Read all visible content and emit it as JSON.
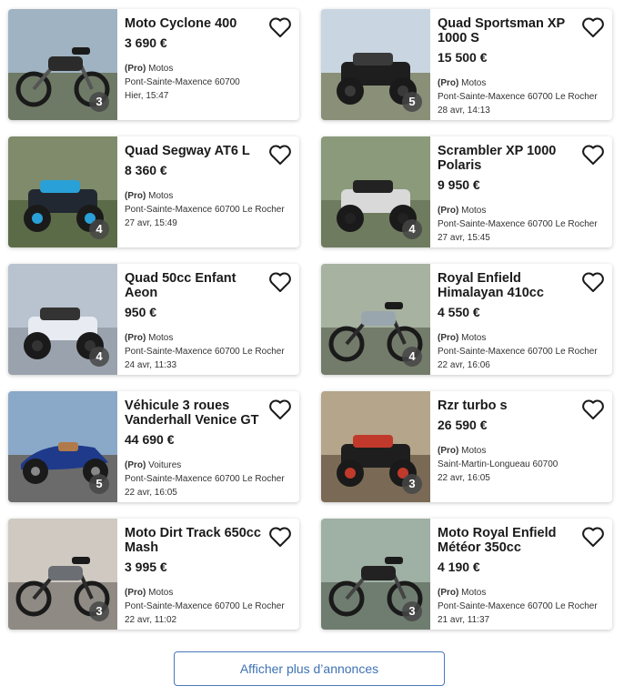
{
  "listings": [
    {
      "title": "Moto Cyclone 400",
      "price": "3 690 €",
      "category_pro": "(Pro)",
      "category": "Motos",
      "location": "Pont-Sainte-Maxence 60700",
      "date": "Hier, 15:47",
      "photos": "3",
      "image": "motorcycle-black-adventure"
    },
    {
      "title": "Quad Sportsman XP 1000 S",
      "price": "15 500 €",
      "category_pro": "(Pro)",
      "category": "Motos",
      "location": "Pont-Sainte-Maxence 60700 Le Rocher",
      "date": "28 avr, 14:13",
      "photos": "5",
      "image": "quad-black"
    },
    {
      "title": "Quad Segway AT6 L",
      "price": "8 360 €",
      "category_pro": "(Pro)",
      "category": "Motos",
      "location": "Pont-Sainte-Maxence 60700 Le Rocher",
      "date": "27 avr, 15:49",
      "photos": "4",
      "image": "quad-blue-black"
    },
    {
      "title": "Scrambler XP 1000 Polaris",
      "price": "9 950 €",
      "category_pro": "(Pro)",
      "category": "Motos",
      "location": "Pont-Sainte-Maxence 60700 Le Rocher",
      "date": "27 avr, 15:45",
      "photos": "4",
      "image": "quad-white-black"
    },
    {
      "title": "Quad 50cc Enfant Aeon",
      "price": "950 €",
      "category_pro": "(Pro)",
      "category": "Motos",
      "location": "Pont-Sainte-Maxence 60700 Le Rocher",
      "date": "24 avr, 11:33",
      "photos": "4",
      "image": "quad-white-kids"
    },
    {
      "title": "Royal Enfield Himalayan 410cc",
      "price": "4 550 €",
      "category_pro": "(Pro)",
      "category": "Motos",
      "location": "Pont-Sainte-Maxence 60700 Le Rocher",
      "date": "22 avr, 16:06",
      "photos": "4",
      "image": "motorcycle-grey"
    },
    {
      "title": "Véhicule 3 roues Vanderhall Venice GT",
      "price": "44 690 €",
      "category_pro": "(Pro)",
      "category": "Voitures",
      "location": "Pont-Sainte-Maxence 60700 Le Rocher",
      "date": "22 avr, 16:05",
      "photos": "5",
      "image": "three-wheeler-blue"
    },
    {
      "title": "Rzr turbo s",
      "price": "26 590 €",
      "category_pro": "(Pro)",
      "category": "Motos",
      "location": "Saint-Martin-Longueau 60700",
      "date": "22 avr, 16:05",
      "photos": "3",
      "image": "buggy-black-red"
    },
    {
      "title": "Moto Dirt Track 650cc Mash",
      "price": "3 995 €",
      "category_pro": "(Pro)",
      "category": "Motos",
      "location": "Pont-Sainte-Maxence 60700 Le Rocher",
      "date": "22 avr, 11:02",
      "photos": "3",
      "image": "motorcycle-grey-retro"
    },
    {
      "title": "Moto Royal Enfield Météor 350cc",
      "price": "4 190 €",
      "category_pro": "(Pro)",
      "category": "Motos",
      "location": "Pont-Sainte-Maxence 60700 Le Rocher",
      "date": "21 avr, 11:37",
      "photos": "3",
      "image": "motorcycle-black-cruiser"
    }
  ],
  "more_button": {
    "label": "Afficher plus d’annonces"
  },
  "colors": {
    "accent": "#3f72b5",
    "badge": "#464646"
  }
}
